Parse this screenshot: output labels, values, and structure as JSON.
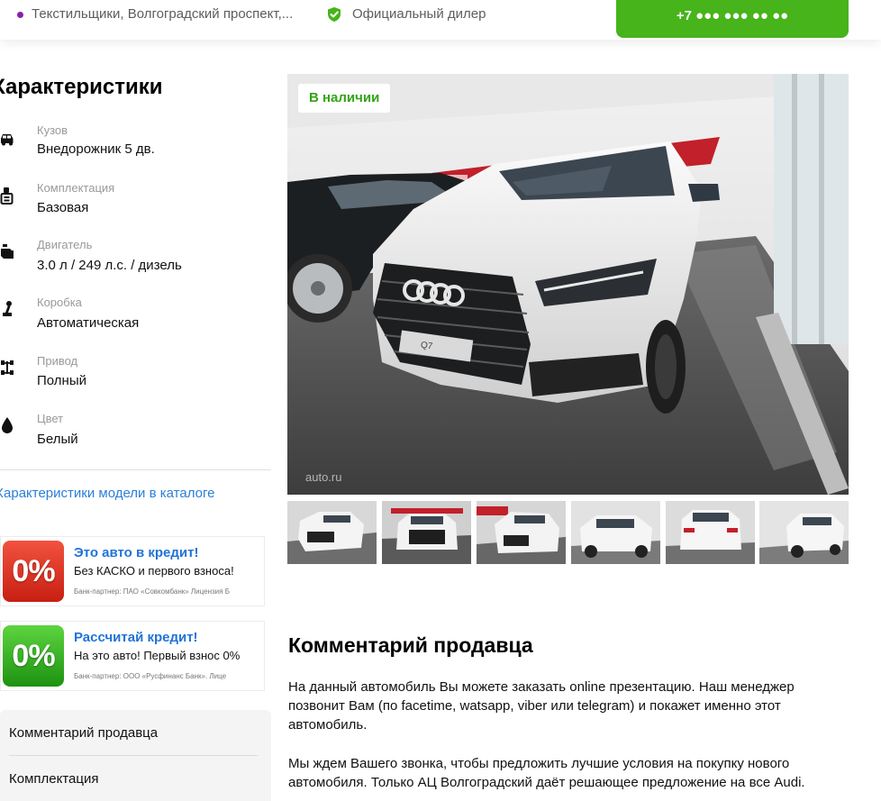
{
  "topbar": {
    "location": "Текстильщики, Волгоградский проспект,...",
    "dealer": "Официальный дилер",
    "phone": "+7 ●●● ●●● ●● ●●"
  },
  "characteristics": {
    "title": "Характеристики",
    "items": [
      {
        "label": "Кузов",
        "value": "Внедорожник 5 дв.",
        "icon": "car-body-icon"
      },
      {
        "label": "Комплектация",
        "value": "Базовая",
        "icon": "trim-icon"
      },
      {
        "label": "Двигатель",
        "value": "3.0 л / 249 л.с. / дизель",
        "icon": "engine-icon"
      },
      {
        "label": "Коробка",
        "value": "Автоматическая",
        "icon": "gearbox-icon"
      },
      {
        "label": "Привод",
        "value": "Полный",
        "icon": "drive-icon"
      },
      {
        "label": "Цвет",
        "value": "Белый",
        "icon": "color-drop-icon"
      }
    ],
    "catalog_link": "Характеристики модели в каталоге"
  },
  "credit": [
    {
      "badge": "0%",
      "title": "Это авто в кредит!",
      "subtitle": "Без КАСКО и первого взноса!",
      "note": "Банк-партнер: ПАО «Совкомбанк» Лицензия Б",
      "color": "#d42a1a"
    },
    {
      "badge": "0%",
      "title": "Рассчитай кредит!",
      "subtitle": "На это авто! Первый взнос 0%",
      "note": "Банк-партнер: ООО «Русфинанс Банк». Лице",
      "color": "#2ea11c"
    }
  ],
  "sidenav": {
    "items": [
      "Комментарий продавца",
      "Комплектация"
    ]
  },
  "gallery": {
    "badge": "В наличии",
    "watermark": "auto.ru",
    "plate": "Q7",
    "thumb_count": 6
  },
  "comment": {
    "title": "Комментарий продавца",
    "paragraphs": [
      "На данный автомобиль Вы можете заказать online презентацию. Наш менеджер позвонит Вам (по facetime, watsapp, viber или telegram) и покажет именно этот автомобиль.",
      "Мы ждем Вашего звонка, чтобы предложить лучшие условия на покупку нового автомобиля. Только АЦ Волгоградский даёт решающее предложение на все Audi."
    ]
  },
  "colors": {
    "accent_green": "#46b41a",
    "link_blue": "#2b7ed8",
    "stock_green": "#34a319"
  }
}
